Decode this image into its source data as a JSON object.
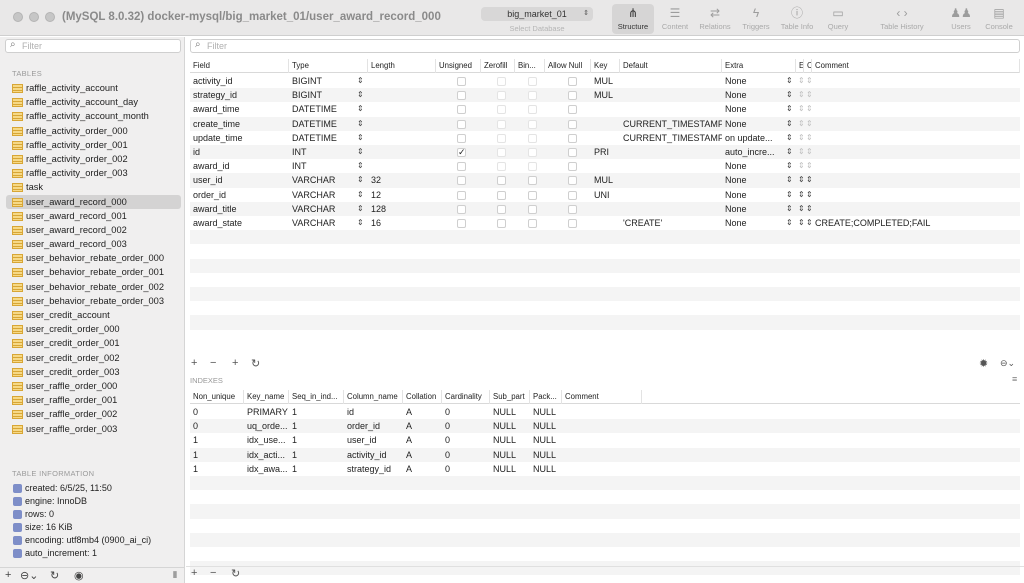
{
  "window": {
    "title": "(MySQL 8.0.32) docker-mysql/big_market_01/user_award_record_000",
    "database": "big_market_01",
    "database_caption": "Select Database"
  },
  "toolbar": [
    {
      "label": "Structure",
      "icon": "structure-icon",
      "glyph": "⋔",
      "active": true
    },
    {
      "label": "Content",
      "icon": "content-icon",
      "glyph": "☰"
    },
    {
      "label": "Relations",
      "icon": "relations-icon",
      "glyph": "⇄"
    },
    {
      "label": "Triggers",
      "icon": "triggers-icon",
      "glyph": "ϟ"
    },
    {
      "label": "Table Info",
      "icon": "table-info-icon",
      "glyph": "ⓘ"
    },
    {
      "label": "Query",
      "icon": "query-icon",
      "glyph": "▭"
    },
    {
      "label": "Table History",
      "icon": "history-icon",
      "glyph": "‹ ›"
    },
    {
      "label": "Users",
      "icon": "users-icon",
      "glyph": "♟♟"
    },
    {
      "label": "Console",
      "icon": "console-icon",
      "glyph": "▤"
    }
  ],
  "sidebar": {
    "filter_placeholder": "Filter",
    "tables_label": "TABLES",
    "tables": [
      "raffle_activity_account",
      "raffle_activity_account_day",
      "raffle_activity_account_month",
      "raffle_activity_order_000",
      "raffle_activity_order_001",
      "raffle_activity_order_002",
      "raffle_activity_order_003",
      "task",
      "user_award_record_000",
      "user_award_record_001",
      "user_award_record_002",
      "user_award_record_003",
      "user_behavior_rebate_order_000",
      "user_behavior_rebate_order_001",
      "user_behavior_rebate_order_002",
      "user_behavior_rebate_order_003",
      "user_credit_account",
      "user_credit_order_000",
      "user_credit_order_001",
      "user_credit_order_002",
      "user_credit_order_003",
      "user_raffle_order_000",
      "user_raffle_order_001",
      "user_raffle_order_002",
      "user_raffle_order_003"
    ],
    "selected_table": "user_award_record_000",
    "info_label": "TABLE INFORMATION",
    "info": [
      "created: 6/5/25, 11:50",
      "engine: InnoDB",
      "rows: 0",
      "size: 16 KiB",
      "encoding: utf8mb4 (0900_ai_ci)",
      "auto_increment: 1"
    ]
  },
  "structure": {
    "filter_placeholder": "Filter",
    "columns": [
      "Field",
      "Type",
      "Length",
      "Unsigned",
      "Zerofill",
      "Binary",
      "Allow Null",
      "Key",
      "Default",
      "Extra",
      "E",
      "C",
      "Comment"
    ],
    "column_labels_shown": [
      "Field",
      "Type",
      "Length",
      "Unsigned",
      "Zerofill",
      "Bin...",
      "Allow Null",
      "Key",
      "Default",
      "Extra",
      "E",
      "C",
      "Comment"
    ],
    "rows": [
      {
        "field": "activity_id",
        "type": "BIGINT",
        "length": "",
        "unsigned": false,
        "allow_null": false,
        "key": "MUL",
        "default": "",
        "extra": "None",
        "comment": ""
      },
      {
        "field": "strategy_id",
        "type": "BIGINT",
        "length": "",
        "unsigned": false,
        "allow_null": false,
        "key": "MUL",
        "default": "",
        "extra": "None",
        "comment": ""
      },
      {
        "field": "award_time",
        "type": "DATETIME",
        "length": "",
        "unsigned": false,
        "allow_null": false,
        "key": "",
        "default": "",
        "extra": "None",
        "comment": ""
      },
      {
        "field": "create_time",
        "type": "DATETIME",
        "length": "",
        "unsigned": false,
        "allow_null": false,
        "key": "",
        "default": "CURRENT_TIMESTAMP",
        "extra": "None",
        "comment": ""
      },
      {
        "field": "update_time",
        "type": "DATETIME",
        "length": "",
        "unsigned": false,
        "allow_null": false,
        "key": "",
        "default": "CURRENT_TIMESTAMP",
        "extra": "on update...",
        "comment": ""
      },
      {
        "field": "id",
        "type": "INT",
        "length": "",
        "unsigned": true,
        "allow_null": false,
        "key": "PRI",
        "default": "",
        "extra": "auto_incre...",
        "comment": ""
      },
      {
        "field": "award_id",
        "type": "INT",
        "length": "",
        "unsigned": false,
        "allow_null": false,
        "key": "",
        "default": "",
        "extra": "None",
        "comment": ""
      },
      {
        "field": "user_id",
        "type": "VARCHAR",
        "length": "32",
        "unsigned": false,
        "allow_null": false,
        "key": "MUL",
        "default": "",
        "extra": "None",
        "comment": ""
      },
      {
        "field": "order_id",
        "type": "VARCHAR",
        "length": "12",
        "unsigned": false,
        "allow_null": false,
        "key": "UNI",
        "default": "",
        "extra": "None",
        "comment": ""
      },
      {
        "field": "award_title",
        "type": "VARCHAR",
        "length": "128",
        "unsigned": false,
        "allow_null": false,
        "key": "",
        "default": "",
        "extra": "None",
        "comment": ""
      },
      {
        "field": "award_state",
        "type": "VARCHAR",
        "length": "16",
        "unsigned": false,
        "allow_null": false,
        "key": "",
        "default": "'CREATE'",
        "extra": "None",
        "comment": "CREATE;COMPLETED;FAIL"
      }
    ]
  },
  "indexes": {
    "label": "INDEXES",
    "columns": [
      "Non_unique",
      "Key_name",
      "Seq_in_ind...",
      "Column_name",
      "Collation",
      "Cardinality",
      "Sub_part",
      "Pack...",
      "Comment"
    ],
    "rows": [
      [
        "0",
        "PRIMARY",
        "1",
        "id",
        "A",
        "0",
        "NULL",
        "NULL",
        ""
      ],
      [
        "0",
        "uq_orde...",
        "1",
        "order_id",
        "A",
        "0",
        "NULL",
        "NULL",
        ""
      ],
      [
        "1",
        "idx_use...",
        "1",
        "user_id",
        "A",
        "0",
        "NULL",
        "NULL",
        ""
      ],
      [
        "1",
        "idx_acti...",
        "1",
        "activity_id",
        "A",
        "0",
        "NULL",
        "NULL",
        ""
      ],
      [
        "1",
        "idx_awa...",
        "1",
        "strategy_id",
        "A",
        "0",
        "NULL",
        "NULL",
        ""
      ]
    ]
  }
}
